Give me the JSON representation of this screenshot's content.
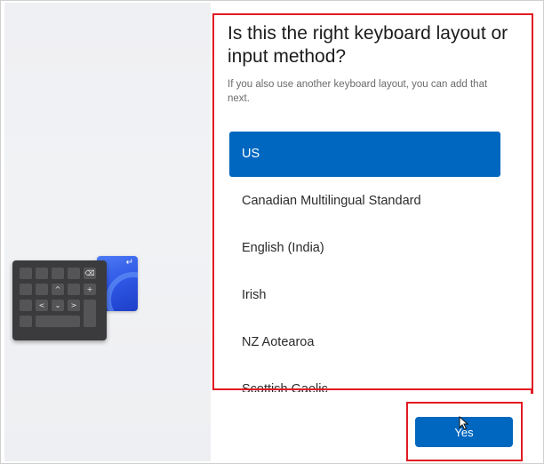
{
  "setup": {
    "heading": "Is this the right keyboard layout or input method?",
    "subtext": "If you also use another keyboard layout, you can add that next.",
    "layouts": [
      {
        "label": "US",
        "selected": true
      },
      {
        "label": "Canadian Multilingual Standard",
        "selected": false
      },
      {
        "label": "English (India)",
        "selected": false
      },
      {
        "label": "Irish",
        "selected": false
      },
      {
        "label": "NZ Aotearoa",
        "selected": false
      },
      {
        "label": "Scottish Gaelic",
        "selected": false
      }
    ],
    "yes_label": "Yes"
  },
  "illustration": {
    "enter_glyph": "↵",
    "keys": [
      "",
      "",
      "",
      "",
      "⌫",
      "",
      "",
      "^",
      "",
      "+",
      "",
      "<",
      "⌄",
      ">",
      ""
    ]
  },
  "colors": {
    "accent": "#0067c0",
    "annotation": "#e01b24",
    "heading_text": "#1b1b1b",
    "subtext": "#6b6b6b"
  },
  "icons": {
    "keyboard": "keyboard-illustration-icon",
    "cursor": "mouse-pointer-icon"
  }
}
